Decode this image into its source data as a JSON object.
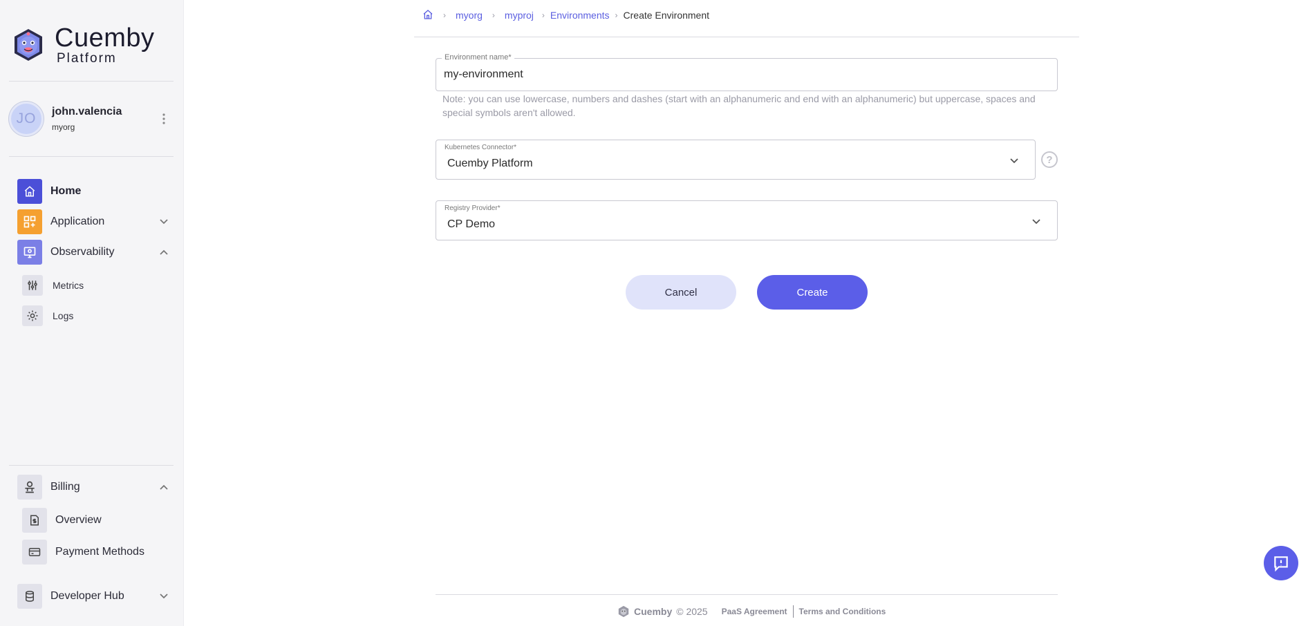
{
  "brand": {
    "name": "Cuemby",
    "sub": "Platform"
  },
  "user": {
    "initials": "JO",
    "name": "john.valencia",
    "org": "myorg"
  },
  "nav": {
    "home": "Home",
    "application": "Application",
    "observability": "Observability",
    "metrics": "Metrics",
    "logs": "Logs",
    "billing": "Billing",
    "overview": "Overview",
    "payment_methods": "Payment Methods",
    "developer_hub": "Developer Hub"
  },
  "breadcrumb": {
    "org": "myorg",
    "project": "myproj",
    "section": "Environments",
    "current": "Create Environment"
  },
  "form": {
    "env_name_label": "Environment name*",
    "env_name_value": "my-environment",
    "note": "Note: you can use lowercase, numbers and dashes (start with an alphanumeric and end with an alphanumeric) but uppercase, spaces and special symbols aren't allowed.",
    "k8s_label": "Kubernetes Connector*",
    "k8s_value": "Cuemby Platform",
    "help": "?",
    "registry_label": "Registry Provider*",
    "registry_value": "CP Demo",
    "cancel": "Cancel",
    "create": "Create"
  },
  "footer": {
    "brand": "Cuemby",
    "copyright": "© 2025",
    "paas": "PaaS Agreement",
    "terms": "Terms and Conditions"
  },
  "colors": {
    "accent": "#5b5ee8",
    "link": "#5a5ee0",
    "home_icon_bg": "#4b4fd8",
    "application_icon_bg": "#f5a030",
    "observability_icon_bg": "#7b7fe6"
  }
}
